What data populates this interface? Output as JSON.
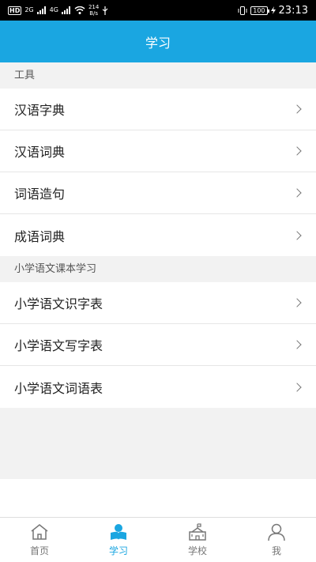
{
  "status_bar": {
    "hd_badge": "HD",
    "net1": "2G",
    "net2": "4G",
    "speed_value": "214",
    "speed_unit": "B/s",
    "battery": "100",
    "time": "23:13"
  },
  "header": {
    "title": "学习"
  },
  "sections": [
    {
      "title": "工具",
      "items": [
        "汉语字典",
        "汉语词典",
        "词语造句",
        "成语词典"
      ]
    },
    {
      "title": "小学语文课本学习",
      "items": [
        "小学语文识字表",
        "小学语文写字表",
        "小学语文词语表"
      ]
    }
  ],
  "tabbar": {
    "active_color": "#1aa6e1",
    "tabs": [
      {
        "label": "首页",
        "icon": "home-icon"
      },
      {
        "label": "学习",
        "icon": "study-icon"
      },
      {
        "label": "学校",
        "icon": "school-icon"
      },
      {
        "label": "我",
        "icon": "profile-icon"
      }
    ]
  }
}
